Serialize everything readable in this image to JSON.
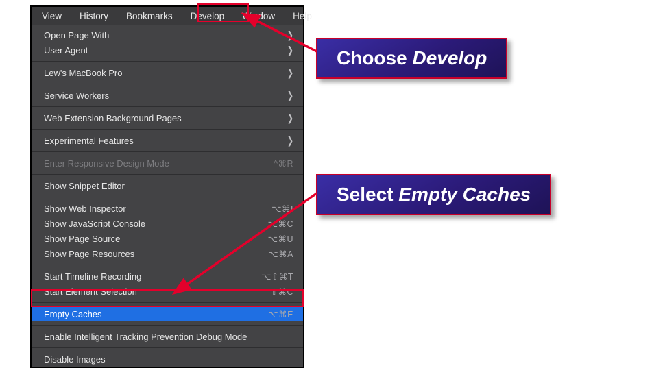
{
  "menubar": {
    "items": [
      "View",
      "History",
      "Bookmarks",
      "Develop",
      "Window",
      "Help"
    ],
    "active_index": 3
  },
  "menu": {
    "items": [
      {
        "label": "Open Page With",
        "sub": true
      },
      {
        "label": "User Agent",
        "sub": true
      },
      {
        "sep": true
      },
      {
        "label": "Lew's MacBook Pro",
        "sub": true
      },
      {
        "sep": true
      },
      {
        "label": "Service Workers",
        "sub": true
      },
      {
        "sep": true
      },
      {
        "label": "Web Extension Background Pages",
        "sub": true
      },
      {
        "sep": true
      },
      {
        "label": "Experimental Features",
        "sub": true
      },
      {
        "sep": true
      },
      {
        "label": "Enter Responsive Design Mode",
        "shortcut": "^⌘R",
        "disabled": true
      },
      {
        "sep": true
      },
      {
        "label": "Show Snippet Editor"
      },
      {
        "sep": true
      },
      {
        "label": "Show Web Inspector",
        "shortcut": "⌥⌘I"
      },
      {
        "label": "Show JavaScript Console",
        "shortcut": "⌥⌘C"
      },
      {
        "label": "Show Page Source",
        "shortcut": "⌥⌘U"
      },
      {
        "label": "Show Page Resources",
        "shortcut": "⌥⌘A"
      },
      {
        "sep": true
      },
      {
        "label": "Start Timeline Recording",
        "shortcut": "⌥⇧⌘T"
      },
      {
        "label": "Start Element Selection",
        "shortcut": "⇧⌘C"
      },
      {
        "sep": true
      },
      {
        "label": "Empty Caches",
        "shortcut": "⌥⌘E",
        "selected": true
      },
      {
        "sep": true
      },
      {
        "label": "Enable Intelligent Tracking Prevention Debug Mode"
      },
      {
        "sep": true
      },
      {
        "label": "Disable Images"
      }
    ]
  },
  "callouts": {
    "a": {
      "text_pre": "Choose ",
      "text_em": "Develop"
    },
    "b": {
      "text_pre": "Select ",
      "text_em": "Empty Caches"
    }
  }
}
